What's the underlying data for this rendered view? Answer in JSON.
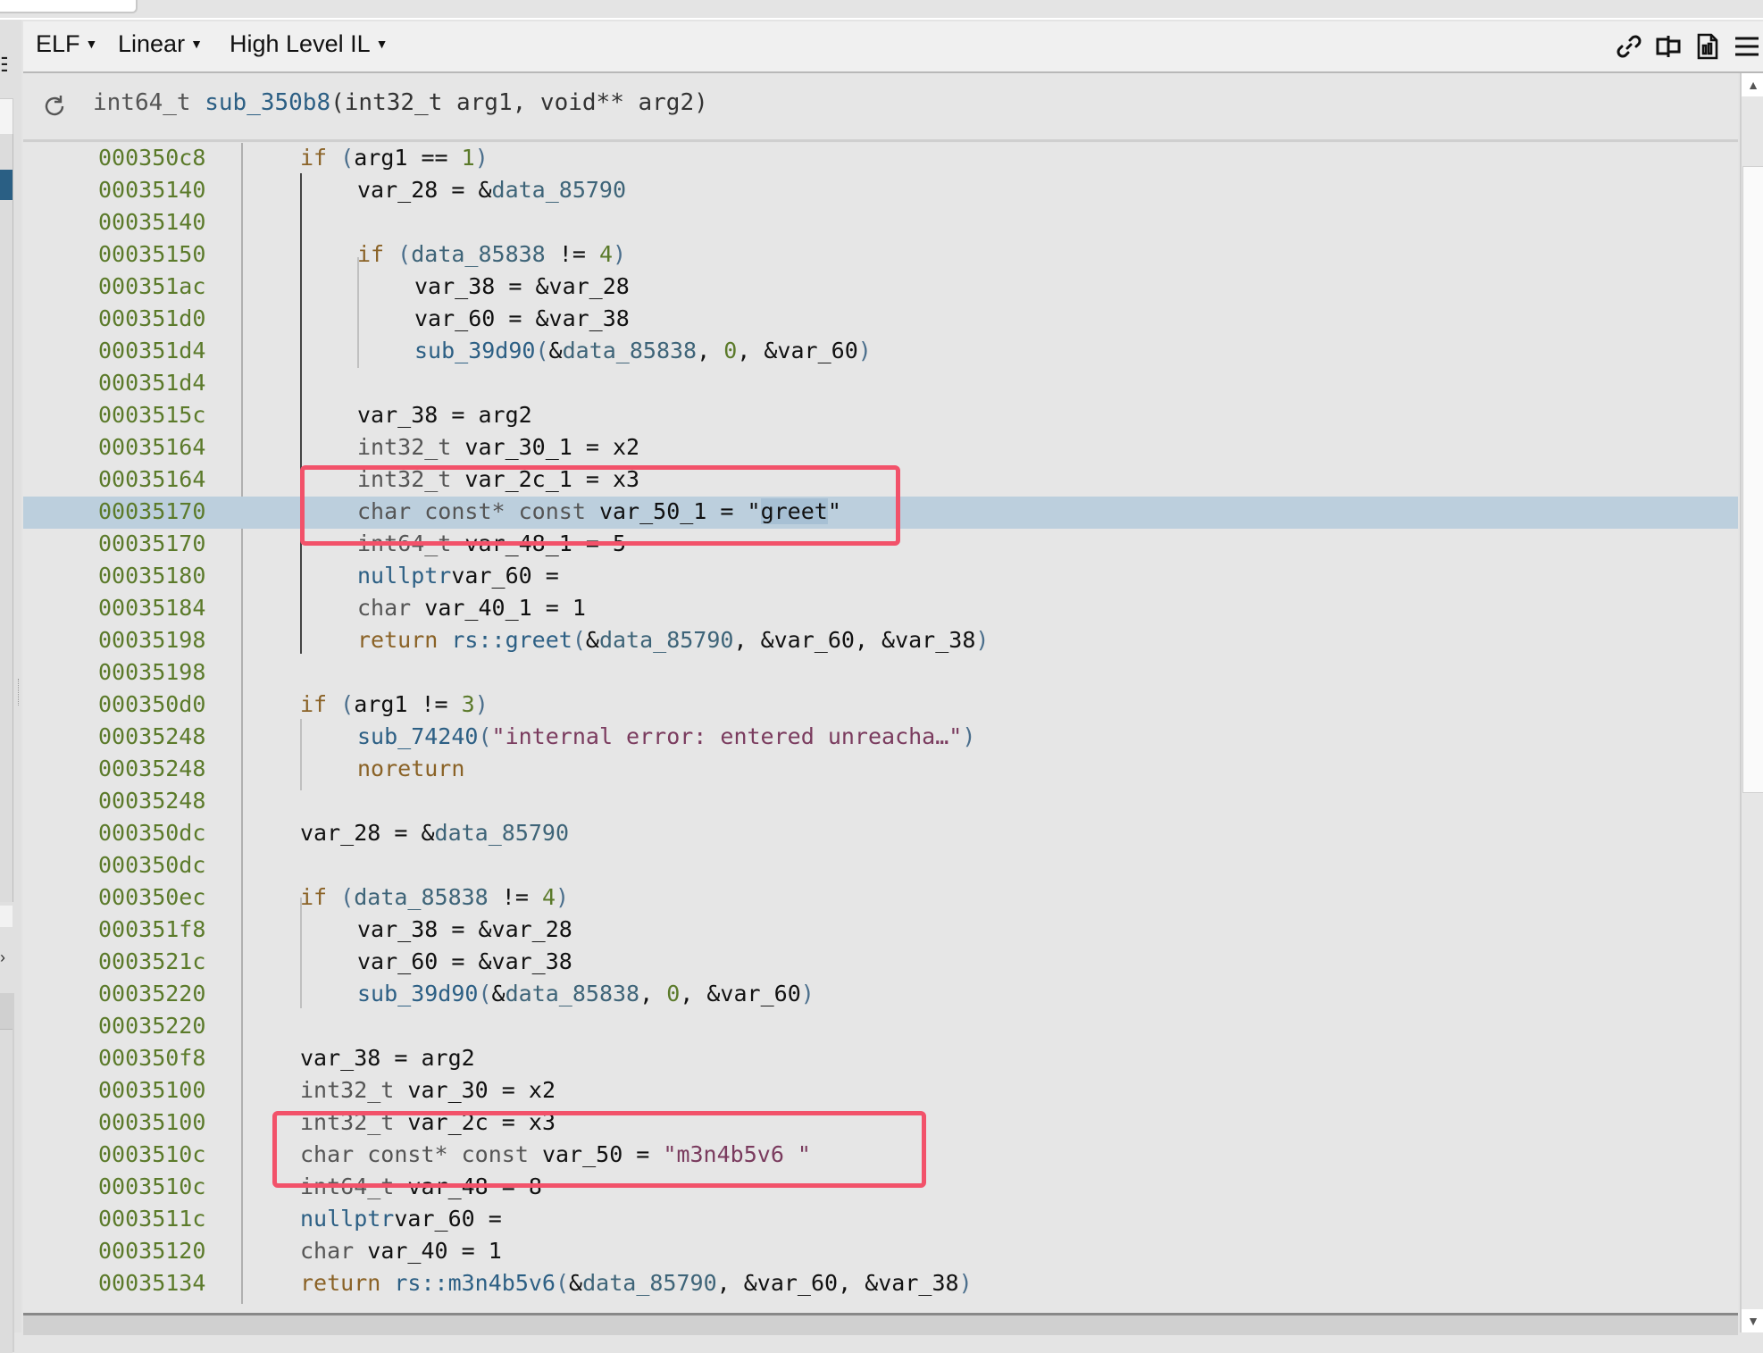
{
  "toolbar": {
    "view_type": "ELF",
    "layout": "Linear",
    "il_level": "High Level IL",
    "icons": [
      "link-icon",
      "split-view-icon",
      "document-icon",
      "hamburger-menu-icon"
    ]
  },
  "header": {
    "return_type": "int64_t",
    "function_name": "sub_350b8",
    "params": "(int32_t arg1, void** arg2)"
  },
  "code": {
    "lines": [
      {
        "addr": "000350c8"
      },
      {
        "addr": "00035140"
      },
      {
        "addr": "00035140"
      },
      {
        "addr": "00035150"
      },
      {
        "addr": "000351ac"
      },
      {
        "addr": "000351d0"
      },
      {
        "addr": "000351d4"
      },
      {
        "addr": "000351d4"
      },
      {
        "addr": "0003515c"
      },
      {
        "addr": "00035164"
      },
      {
        "addr": "00035164"
      },
      {
        "addr": "00035170",
        "highlighted": true
      },
      {
        "addr": "00035170"
      },
      {
        "addr": "00035180"
      },
      {
        "addr": "00035184"
      },
      {
        "addr": "00035198"
      },
      {
        "addr": "00035198"
      },
      {
        "addr": "000350d0"
      },
      {
        "addr": "00035248"
      },
      {
        "addr": "00035248"
      },
      {
        "addr": "00035248"
      },
      {
        "addr": "000350dc"
      },
      {
        "addr": "000350dc"
      },
      {
        "addr": "000350ec"
      },
      {
        "addr": "000351f8"
      },
      {
        "addr": "0003521c"
      },
      {
        "addr": "00035220"
      },
      {
        "addr": "00035220"
      },
      {
        "addr": "000350f8"
      },
      {
        "addr": "00035100"
      },
      {
        "addr": "00035100"
      },
      {
        "addr": "0003510c"
      },
      {
        "addr": "0003510c"
      },
      {
        "addr": "0003511c"
      },
      {
        "addr": "00035120"
      },
      {
        "addr": "00035134"
      }
    ],
    "tokens": {
      "l0": {
        "kw": "if",
        "open": " (",
        "a": "arg1 == ",
        "n": "1",
        "close": ")"
      },
      "l1": {
        "a": "var_28 = &",
        "d": "data_85790"
      },
      "l3": {
        "kw": "if",
        "open": " (",
        "d": "data_85838",
        "a": " != ",
        "n": "4",
        "close": ")"
      },
      "l4": {
        "a": "var_38 = &var_28"
      },
      "l5": {
        "a": "var_60 = &var_38"
      },
      "l6": {
        "f": "sub_39d90",
        "open": "(",
        "a": "&",
        "d": "data_85838",
        "c": ", ",
        "n": "0",
        "b": ", &var_60",
        "close": ")"
      },
      "l8": {
        "a": "var_38 = arg2"
      },
      "l9": {
        "t": "int32_t ",
        "v": "var_30_1 = ",
        "x": "x2"
      },
      "l10": {
        "t": "int32_t ",
        "v": "var_2c_1 = ",
        "x": "x3"
      },
      "l11": {
        "t": "char const* const ",
        "v": "var_50_1 = ",
        "q1": "\"",
        "s": "greet",
        "q2": "\""
      },
      "l12": {
        "t": "int64_t ",
        "v": "var_48_1 = ",
        "x": "5"
      },
      "l13": {
        "a": "var_60 = ",
        "f": "nullptr"
      },
      "l14": {
        "t": "char ",
        "v": "var_40_1 = ",
        "x": "1"
      },
      "l15": {
        "kw": "return ",
        "f": "rs::greet",
        "open": "(",
        "a": "&",
        "d": "data_85790",
        "b": ", &var_60, &var_38",
        "close": ")"
      },
      "l17": {
        "kw": "if",
        "open": " (",
        "a": "arg1 != ",
        "n": "3",
        "close": ")"
      },
      "l18": {
        "f": "sub_74240",
        "open": "(",
        "s": "\"internal error: entered unreacha…\"",
        "close": ")"
      },
      "l19": {
        "kw": "noreturn"
      },
      "l21": {
        "a": "var_28 = &",
        "d": "data_85790"
      },
      "l23": {
        "kw": "if",
        "open": " (",
        "d": "data_85838",
        "a": " != ",
        "n": "4",
        "close": ")"
      },
      "l24": {
        "a": "var_38 = &var_28"
      },
      "l25": {
        "a": "var_60 = &var_38"
      },
      "l26": {
        "f": "sub_39d90",
        "open": "(",
        "a": "&",
        "d": "data_85838",
        "c": ", ",
        "n": "0",
        "b": ", &var_60",
        "close": ")"
      },
      "l28": {
        "a": "var_38 = arg2"
      },
      "l29": {
        "t": "int32_t ",
        "v": "var_30 = ",
        "x": "x2"
      },
      "l30": {
        "t": "int32_t ",
        "v": "var_2c = ",
        "x": "x3"
      },
      "l31": {
        "t": "char const* const ",
        "v": "var_50 = ",
        "s": "\"m3n4b5v6 \""
      },
      "l32": {
        "t": "int64_t ",
        "v": "var_48 = ",
        "x": "8"
      },
      "l33": {
        "a": "var_60 = ",
        "f": "nullptr"
      },
      "l34": {
        "t": "char ",
        "v": "var_40 = ",
        "x": "1"
      },
      "l35": {
        "kw": "return ",
        "f": "rs::m3n4b5v6",
        "open": "(",
        "a": "&",
        "d": "data_85790",
        "b": ", &var_60, &var_38",
        "close": ")"
      }
    }
  },
  "annotations": {
    "highlight_color": "#f2526a",
    "boxes": [
      "var_2c_1 / var_50_1 \"greet\"",
      "var_2c / var_50 \"m3n4b5v6 \""
    ]
  },
  "colors": {
    "address": "#5b7a2a",
    "keyword": "#8a6226",
    "function": "#2c5f84",
    "data_symbol": "#3e6478",
    "string": "#7a3b5e",
    "selected_line": "#bccfdd"
  }
}
